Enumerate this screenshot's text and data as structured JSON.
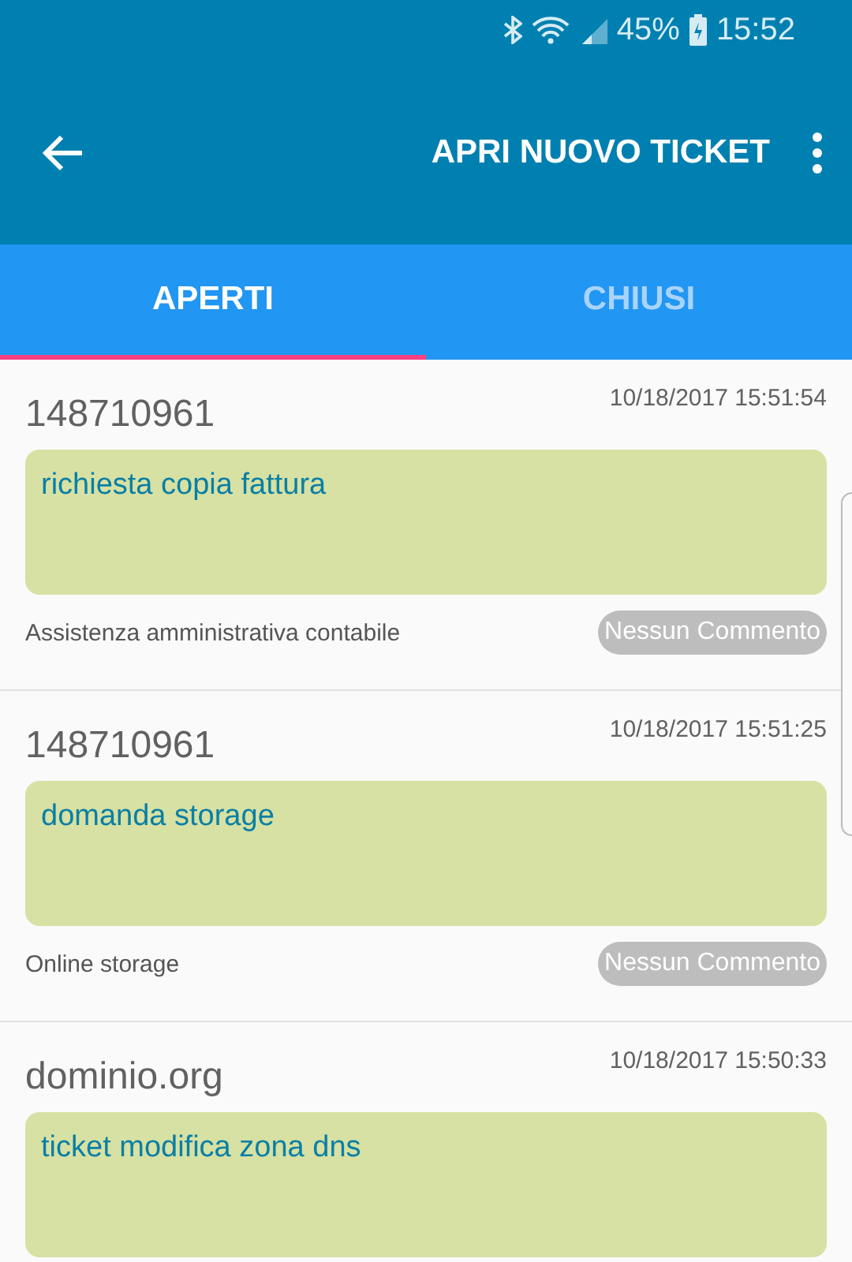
{
  "status_bar": {
    "battery": "45%",
    "time": "15:52"
  },
  "app_bar": {
    "title": "APRI NUOVO TICKET"
  },
  "tabs": [
    {
      "label": "APERTI",
      "selected": true
    },
    {
      "label": "CHIUSI",
      "selected": false
    }
  ],
  "tickets": [
    {
      "domain": "148710961",
      "date": "10/18/2017 15:51:54",
      "subject": "richiesta copia fattura",
      "category": "Assistenza amministrativa contabile",
      "comments": "Nessun Commento"
    },
    {
      "domain": "148710961",
      "date": "10/18/2017 15:51:25",
      "subject": "domanda storage",
      "category": "Online storage",
      "comments": "Nessun Commento"
    },
    {
      "domain": "dominio.org",
      "date": "10/18/2017 15:50:33",
      "subject": "ticket modifica zona dns"
    }
  ]
}
